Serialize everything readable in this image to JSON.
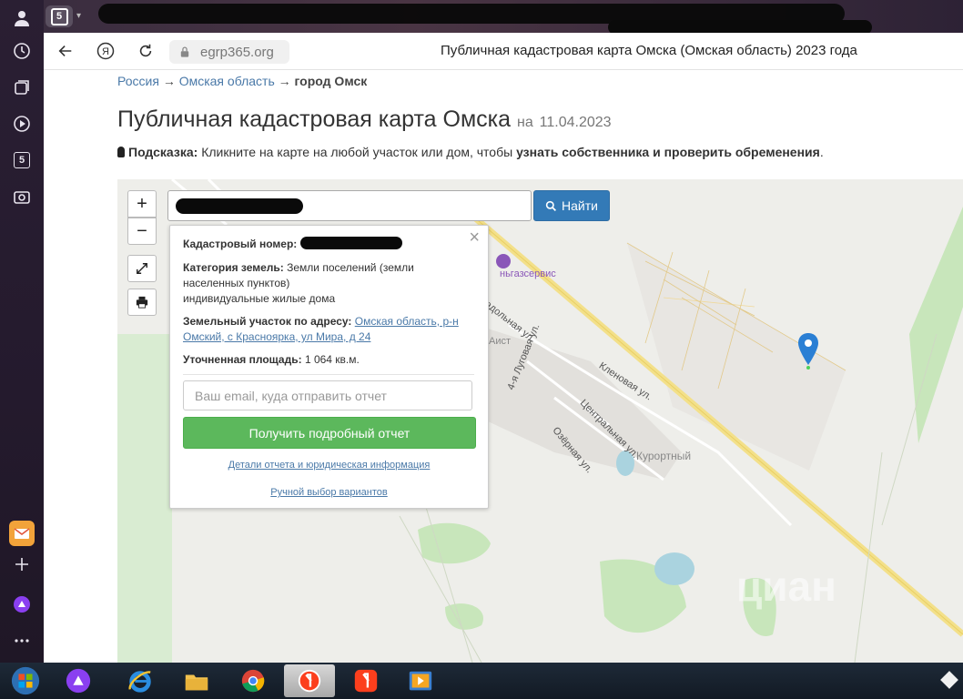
{
  "browser": {
    "tab_count": "5",
    "url": "egrp365.org",
    "window_title": "Публичная кадастровая карта Омска (Омская область) 2023 года",
    "sidebar_badge": "5"
  },
  "breadcrumb": {
    "items": [
      "Россия",
      "Омская область",
      "город Омск"
    ],
    "separator": "→"
  },
  "page": {
    "title": "Публичная кадастровая карта Омска",
    "date_prefix": "на",
    "date": "11.04.2023",
    "hint_label": "Подсказка:",
    "hint_text": "Кликните на карте на любой участок или дом, чтобы",
    "hint_bold": "узнать собственника и проверить обременения",
    "hint_end": "."
  },
  "map": {
    "zoom_in": "+",
    "zoom_out": "−",
    "search_button": "Найти",
    "labels": {
      "gas": "ньгазсервис",
      "aist": "Аист",
      "kurortny": "Курортный",
      "street1": "адольная ул.",
      "street2": "4-я Луговая ул.",
      "street3": "Кленовая ул.",
      "street4": "Центральная ул.",
      "street5": "Озёрная ул.",
      "watermark": "циан"
    }
  },
  "popup": {
    "cadastral_label": "Кадастровый номер:",
    "category_label": "Категория земель:",
    "category_value": "Земли поселений (земли населенных пунктов)",
    "category_use": "индивидуальные жилые дома",
    "address_label": "Земельный участок по адресу:",
    "address_value": "Омская область, р-н Омский, с Красноярка, ул Мира, д 24",
    "area_label": "Уточненная площадь:",
    "area_value": "1 064 кв.м.",
    "email_placeholder": "Ваш email, куда отправить отчет",
    "report_button": "Получить подробный отчет",
    "details_link": "Детали отчета и юридическая информация",
    "manual_link": "Ручной выбор вариантов",
    "close": "×"
  },
  "colors": {
    "link": "#4a79a8",
    "primary": "#337ab7",
    "success": "#5cb85c",
    "marker": "#2a7fd4"
  }
}
